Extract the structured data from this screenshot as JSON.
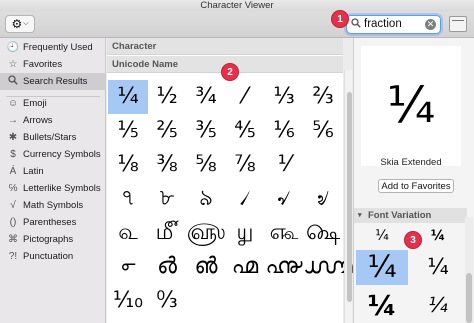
{
  "window": {
    "title": "Character Viewer"
  },
  "toolbar": {
    "gear_icon": "⚙",
    "chevron_icon": "⌵",
    "search_value": "fraction",
    "search_icon": "🔍",
    "clear_icon": "✕"
  },
  "badges": [
    "1",
    "2",
    "3"
  ],
  "sidebar": {
    "items": [
      {
        "icon": "🕘",
        "label": "Frequently Used"
      },
      {
        "icon": "☆",
        "label": "Favorites"
      },
      {
        "icon": "🔍",
        "label": "Search Results",
        "selected": true
      },
      {
        "icon": "☺",
        "label": "Emoji"
      },
      {
        "icon": "→",
        "label": "Arrows"
      },
      {
        "icon": "✱",
        "label": "Bullets/Stars"
      },
      {
        "icon": "$",
        "label": "Currency Symbols"
      },
      {
        "icon": "Á",
        "label": "Latin"
      },
      {
        "icon": "℅",
        "label": "Letterlike Symbols"
      },
      {
        "icon": "√",
        "label": "Math Symbols"
      },
      {
        "icon": "()",
        "label": "Parentheses"
      },
      {
        "icon": "⌘",
        "label": "Pictographs"
      },
      {
        "icon": "?!",
        "label": "Punctuation"
      }
    ]
  },
  "center": {
    "header_character": "Character",
    "header_unicode": "Unicode Name",
    "characters": [
      "¼",
      "½",
      "¾",
      "⁄",
      "⅓",
      "⅔",
      "⅕",
      "⅖",
      "⅗",
      "⅘",
      "⅙",
      "⅚",
      "⅛",
      "⅜",
      "⅝",
      "⅞",
      "⅟",
      "",
      "৭",
      "৮",
      "৯",
      "৴",
      "৵",
      "৶",
      "௳",
      "௴",
      "௵",
      "௶",
      "௷",
      "௸",
      "൳",
      "൴",
      "൵",
      "൶",
      "൷",
      "൸",
      "⅒",
      "↉"
    ]
  },
  "right": {
    "preview_char": "¼",
    "font_name": "Skia Extended",
    "add_favorites": "Add to Favorites",
    "font_variation_header": "Font Variation",
    "variations": [
      "¼",
      "¼",
      "¼",
      "¼",
      "¼",
      "¼"
    ]
  }
}
